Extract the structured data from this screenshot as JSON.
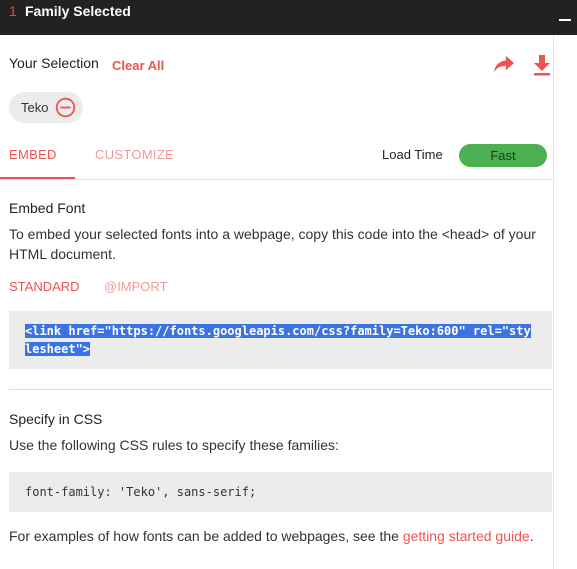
{
  "header": {
    "count": "1",
    "title": "Family Selected"
  },
  "selection": {
    "label": "Your Selection",
    "clear_label": "Clear All",
    "chip_name": "Teko"
  },
  "tabs": {
    "embed": "EMBED",
    "customize": "CUSTOMIZE"
  },
  "load": {
    "label": "Load Time",
    "value": "Fast",
    "color": "#4caf50"
  },
  "embed_section": {
    "title": "Embed Font",
    "description_line1": "To embed your selected fonts into a webpage, copy this code into the <head> of your",
    "description_line2": "HTML document.",
    "subtab_standard": "STANDARD",
    "subtab_import": "@IMPORT",
    "code_line1": "<link href=\"https://fonts.googleapis.com/css?family=Teko:600\" rel=\"sty",
    "code_line2": "lesheet\">"
  },
  "css_section": {
    "title": "Specify in CSS",
    "description": "Use the following CSS rules to specify these families:",
    "code": "font-family: 'Teko', sans-serif;"
  },
  "footer": {
    "text": "For examples of how fonts can be added to webpages, see the ",
    "link": "getting started guide",
    "suffix": "."
  },
  "icons": {
    "share": "share-arrow-icon",
    "download": "download-icon",
    "remove": "remove-circle-icon",
    "minimize": "minimize-icon"
  },
  "colors": {
    "accent": "#ef5350",
    "header_bg": "#222222",
    "highlight": "#3b73e4"
  }
}
